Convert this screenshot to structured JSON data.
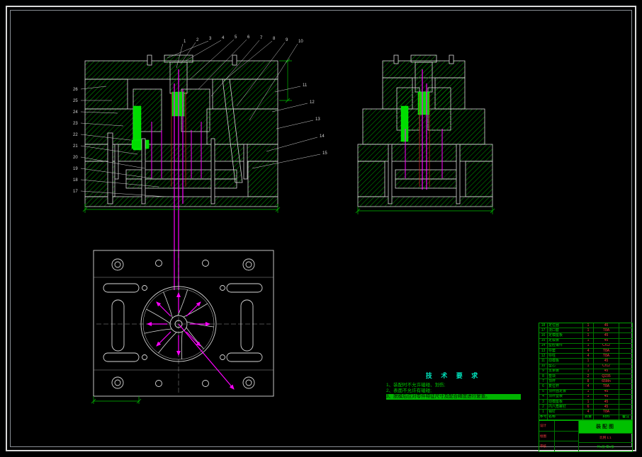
{
  "colors": {
    "background": "#000000",
    "frame": "#d9d9d9",
    "hatch_green": "#00a000",
    "highlight_green": "#00dd00",
    "magenta": "#ff00ff",
    "red": "#cc2222",
    "dim_green": "#00bb00"
  },
  "callouts": {
    "top": [
      "1",
      "2",
      "3",
      "4",
      "5",
      "6",
      "7",
      "8",
      "9",
      "10"
    ],
    "right": [
      "11",
      "12",
      "13",
      "14",
      "15"
    ],
    "left": [
      "26",
      "25",
      "24",
      "23",
      "22",
      "21",
      "20",
      "19",
      "18",
      "17"
    ]
  },
  "tech_requirements": {
    "title": "技 术 要 求",
    "items": [
      {
        "text": "1、装配时不允许磕碰、划伤;",
        "highlight": false
      },
      {
        "text": "2、表面不允许有磕碰;",
        "highlight": false
      },
      {
        "text": "3、脱模后应对零件特征尺寸及配合精度进行复查。",
        "highlight": true
      }
    ]
  },
  "parts_table": {
    "header": [
      "序号",
      "名称",
      "数量",
      "材料",
      "备注"
    ],
    "rows": [
      [
        "18",
        "定位圈",
        "1",
        "45",
        ""
      ],
      [
        "17",
        "浇口套",
        "1",
        "T8A",
        ""
      ],
      [
        "16",
        "定模座板",
        "1",
        "45",
        ""
      ],
      [
        "15",
        "定模板",
        "1",
        "45",
        ""
      ],
      [
        "14",
        "型腔镶件",
        "1",
        "Cr12",
        ""
      ],
      [
        "13",
        "导套",
        "4",
        "T8A",
        ""
      ],
      [
        "12",
        "导柱",
        "4",
        "T8A",
        ""
      ],
      [
        "11",
        "动模板",
        "1",
        "45",
        ""
      ],
      [
        "10",
        "型芯",
        "1",
        "Cr12",
        ""
      ],
      [
        "9",
        "支承板",
        "1",
        "45",
        ""
      ],
      [
        "8",
        "垫块",
        "2",
        "Q235",
        ""
      ],
      [
        "7",
        "顶杆",
        "8",
        "65Mn",
        ""
      ],
      [
        "6",
        "复位杆",
        "4",
        "T8A",
        ""
      ],
      [
        "5",
        "顶杆固定板",
        "1",
        "45",
        ""
      ],
      [
        "4",
        "顶杆垫板",
        "1",
        "45",
        ""
      ],
      [
        "3",
        "动模座板",
        "1",
        "45",
        ""
      ],
      [
        "2",
        "内六角螺钉",
        "6",
        "45",
        ""
      ],
      [
        "1",
        "销钉",
        "4",
        "T8A",
        ""
      ]
    ]
  },
  "title_block": {
    "title": "装配图",
    "scale_text": "比例 1:1",
    "sheet_text": "共1张 第1张",
    "row_labels": [
      "设计",
      "绘图",
      "审核"
    ]
  }
}
